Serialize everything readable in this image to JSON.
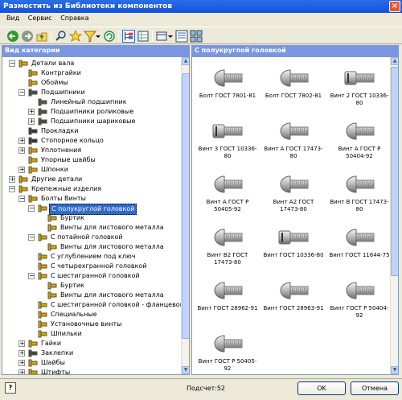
{
  "window": {
    "title": "Разместить из Библиотеки компонентов",
    "close_glyph": "×"
  },
  "menu": [
    "Вид",
    "Сервис",
    "Справка"
  ],
  "toolbar_icons": [
    "back-icon",
    "forward-icon",
    "up-icon",
    "search-icon",
    "favorites-icon",
    "filter-icon",
    "refresh-icon",
    "tree-view-icon",
    "table-view-icon",
    "view-options-icon",
    "details-view-icon",
    "thumbnails-view-icon"
  ],
  "left_panel": {
    "header": "Вид категории"
  },
  "right_panel": {
    "header": "С полукруглой головкой"
  },
  "tree": [
    {
      "label": "Детали вала",
      "indent": 0,
      "expander": "−",
      "icon": "shaft"
    },
    {
      "label": "Контргайки",
      "indent": 1,
      "expander": "",
      "icon": "nut"
    },
    {
      "label": "Обоймы",
      "indent": 1,
      "expander": "",
      "icon": "cage"
    },
    {
      "label": "Подшипники",
      "indent": 1,
      "expander": "−",
      "icon": "bearing"
    },
    {
      "label": "Линейный подшипник",
      "indent": 2,
      "expander": "",
      "icon": "linear"
    },
    {
      "label": "Подшипники роликовые",
      "indent": 2,
      "expander": "+",
      "icon": "bearing"
    },
    {
      "label": "Подшипники шариковые",
      "indent": 2,
      "expander": "+",
      "icon": "bearing"
    },
    {
      "label": "Прокладки",
      "indent": 1,
      "expander": "",
      "icon": "gasket"
    },
    {
      "label": "Стопорное кольцо",
      "indent": 1,
      "expander": "+",
      "icon": "ring"
    },
    {
      "label": "Уплотнения",
      "indent": 1,
      "expander": "+",
      "icon": "seal"
    },
    {
      "label": "Упорные шайбы",
      "indent": 1,
      "expander": "",
      "icon": "washer"
    },
    {
      "label": "Шпонки",
      "indent": 1,
      "expander": "+",
      "icon": "key"
    },
    {
      "label": "Другие детали",
      "indent": 0,
      "expander": "+",
      "icon": "other"
    },
    {
      "label": "Крепежные изделия",
      "indent": 0,
      "expander": "−",
      "icon": "fastener"
    },
    {
      "label": "Болты  Винты",
      "indent": 1,
      "expander": "−",
      "icon": "bolt"
    },
    {
      "label": "С полукруглой головкой",
      "indent": 2,
      "expander": "−",
      "icon": "bolt",
      "selected": true
    },
    {
      "label": "Буртик",
      "indent": 3,
      "expander": "",
      "icon": "bolt"
    },
    {
      "label": "Винты для листового металла",
      "indent": 3,
      "expander": "",
      "icon": "bolt"
    },
    {
      "label": "С потайной головкой",
      "indent": 2,
      "expander": "−",
      "icon": "bolt"
    },
    {
      "label": "Винты для листового металла",
      "indent": 3,
      "expander": "",
      "icon": "bolt"
    },
    {
      "label": "С углублением под ключ",
      "indent": 2,
      "expander": "",
      "icon": "bolt"
    },
    {
      "label": "С четырехгранной головкой",
      "indent": 2,
      "expander": "",
      "icon": "bolt"
    },
    {
      "label": "С шестигранной головкой",
      "indent": 2,
      "expander": "−",
      "icon": "bolt"
    },
    {
      "label": "Буртик",
      "indent": 3,
      "expander": "",
      "icon": "bolt"
    },
    {
      "label": "Винты для листового металла",
      "indent": 3,
      "expander": "",
      "icon": "bolt"
    },
    {
      "label": "С шестигранной головкой - фланцевой",
      "indent": 2,
      "expander": "",
      "icon": "bolt"
    },
    {
      "label": "Специальные",
      "indent": 2,
      "expander": "",
      "icon": "bolt"
    },
    {
      "label": "Установочные винты",
      "indent": 2,
      "expander": "",
      "icon": "bolt"
    },
    {
      "label": "Шпильки",
      "indent": 2,
      "expander": "",
      "icon": "bolt"
    },
    {
      "label": "Гайки",
      "indent": 1,
      "expander": "+",
      "icon": "nut"
    },
    {
      "label": "Заклепки",
      "indent": 1,
      "expander": "+",
      "icon": "rivet"
    },
    {
      "label": "Шайбы",
      "indent": 1,
      "expander": "+",
      "icon": "washer"
    },
    {
      "label": "Штифты",
      "indent": 1,
      "expander": "+",
      "icon": "pin"
    }
  ],
  "components": [
    {
      "label": "Болт ГОСТ 7801-81",
      "head": "round"
    },
    {
      "label": "Болт ГОСТ 7802-81",
      "head": "round"
    },
    {
      "label": "Винт 2 ГОСТ 10336-80",
      "head": "slotcyl"
    },
    {
      "label": "Винт 3 ГОСТ 10336-80",
      "head": "slotcyl"
    },
    {
      "label": "Винт А ГОСТ 17473-80",
      "head": "round"
    },
    {
      "label": "Винт А ГОСТ Р 50404-92",
      "head": "round"
    },
    {
      "label": "Винт А ГОСТ Р 50405-92",
      "head": "round"
    },
    {
      "label": "Винт А2 ГОСТ 17473-80",
      "head": "round"
    },
    {
      "label": "Винт В ГОСТ 17473-80",
      "head": "round"
    },
    {
      "label": "Винт В2 ГОСТ 17473-80",
      "head": "round"
    },
    {
      "label": "Винт ГОСТ 10336-80",
      "head": "slotcyl"
    },
    {
      "label": "Винт ГОСТ 11644-75",
      "head": "round"
    },
    {
      "label": "Винт ГОСТ 28962-91",
      "head": "round"
    },
    {
      "label": "Винт ГОСТ 28963-91",
      "head": "round"
    },
    {
      "label": "Винт ГОСТ Р 50404-92",
      "head": "round"
    },
    {
      "label": "Винт ГОСТ Р 50405-92",
      "head": "round"
    }
  ],
  "status": {
    "count_text": "Подсчет:52"
  },
  "buttons": {
    "help": "?",
    "ok": "OK",
    "cancel": "Отмена"
  }
}
